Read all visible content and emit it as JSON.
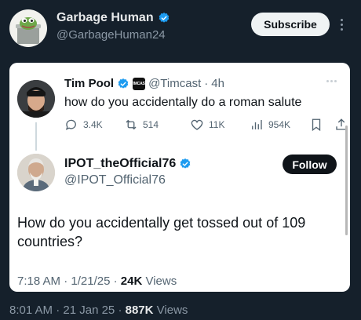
{
  "post": {
    "author_name": "Garbage Human",
    "author_handle": "@GarbageHuman24",
    "subscribe_label": "Subscribe",
    "time": "8:01 AM",
    "date": "21 Jan 25",
    "views_count": "887K",
    "views_label": "Views"
  },
  "quoted": {
    "tweet1": {
      "author_name": "Tim Pool",
      "affiliate_badge_text": "TIMCAST",
      "author_handle": "@Timcast",
      "age": "4h",
      "text": "how do you accidentally do a roman salute",
      "replies": "3.4K",
      "reposts": "514",
      "likes": "11K",
      "views": "954K"
    },
    "tweet2": {
      "author_name": "IPOT_theOfficial76",
      "author_handle": "@IPOT_Official76",
      "follow_label": "Follow",
      "text": "How do you accidentally get tossed out of 109 countries?",
      "time": "7:18 AM",
      "date": "1/21/25",
      "views_count": "24K",
      "views_label": "Views"
    }
  },
  "colors": {
    "background": "#15202b",
    "verified": "#1d9bf0",
    "card": "#ffffff"
  },
  "icons": [
    "verified-icon",
    "more-icon",
    "reply-icon",
    "repost-icon",
    "like-icon",
    "views-icon",
    "bookmark-icon",
    "share-icon"
  ]
}
